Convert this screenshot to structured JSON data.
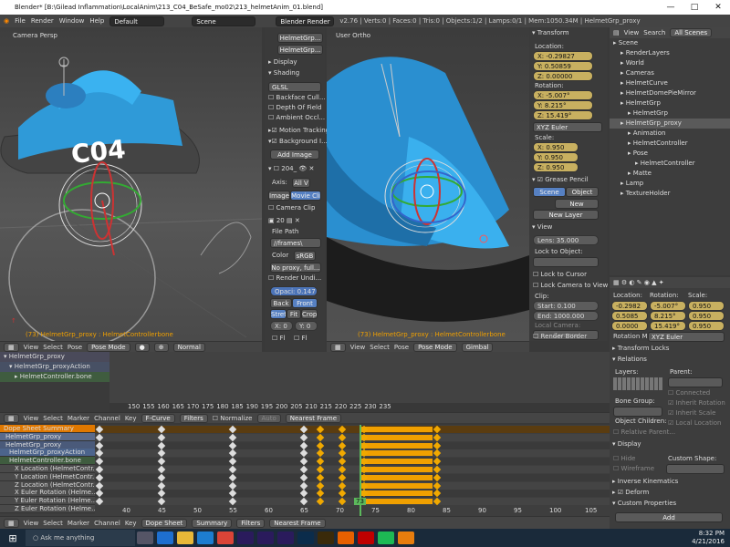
{
  "window": {
    "title": "Blender* [B:\\Gilead Inflammation\\LocalAnim\\213_C04_BeSafe_mo02\\213_helmetAnim_01.blend]",
    "min": "—",
    "max": "□",
    "close": "✕"
  },
  "topbar": {
    "menus": [
      "File",
      "Render",
      "Window",
      "Help"
    ],
    "layout": "Default",
    "scene": "Scene",
    "engine": "Blender Render",
    "info": "v2.76 | Verts:0 | Faces:0 | Tris:0 | Objects:1/2 | Lamps:0/1 | Mem:1050.34M | HelmetGrp_proxy"
  },
  "left_viewport": {
    "label": "Camera Persp",
    "status": "(73) HelmetGrp_proxy : HelmetControllerbone",
    "helmet_text": "C04",
    "menu": [
      "View",
      "Select",
      "Pose"
    ],
    "mode": "Pose Mode",
    "pivot": "Normal"
  },
  "shading_panel": {
    "items": [
      "HelmetGrp...",
      "HelmetGrp..."
    ],
    "display": "Display",
    "shading": "Shading",
    "glsl": "GLSL",
    "checks": [
      "Backface Cull...",
      "Depth Of Field",
      "Ambient Occl...",
      "Motion Tracking",
      "Background I..."
    ],
    "add_image": "Add Image",
    "img_name": "204_",
    "axis_label": "Axis:",
    "axis_val": "All V",
    "image_btn": "Image",
    "movie_btn": "Movie Cli",
    "camera_clip": "Camera Clip",
    "frame": "20",
    "file_path": "File Path",
    "path_val": "//frames\\",
    "color": "Color",
    "srgb": "sRGB",
    "no_proxy": "No proxy, full...",
    "render_undist": "Render Undi...",
    "opac": "Opaci: 0.147",
    "back": "Back",
    "front": "Front",
    "stretch": "Stret",
    "fit": "Fit",
    "crop": "Crop",
    "x": "X: 0",
    "y": "Y: 0",
    "fl": "Fl",
    "fl2": "Fl"
  },
  "right_viewport": {
    "label": "User Ortho",
    "status": "(73) HelmetGrp_proxy : HelmetControllerbone",
    "menu": [
      "View",
      "Select",
      "Pose"
    ],
    "mode": "Pose Mode",
    "orient": "Gimbal"
  },
  "transform": {
    "title": "Transform",
    "location": "Location:",
    "loc": [
      "X: -0.29827",
      "Y: 0.50859",
      "Z: 0.00000"
    ],
    "rotation": "Rotation:",
    "rot": [
      "X: -5.007°",
      "Y: 8.215°",
      "Z: 15.419°"
    ],
    "euler": "XYZ Euler",
    "scale": "Scale:",
    "scl": [
      "X: 0.950",
      "Y: 0.950",
      "Z: 0.950"
    ],
    "grease": "Grease Pencil",
    "scene_btn": "Scene",
    "object_btn": "Object",
    "new": "New",
    "new_layer": "New Layer",
    "view": "View",
    "lens": "Lens: 35.000",
    "lock_obj": "Lock to Object:",
    "lock_cursor": "Lock to Cursor",
    "lock_cam": "Lock Camera to View",
    "clip": "Clip:",
    "start": "Start: 0.100",
    "end": "End: 1000.000",
    "local_camera": "Local Camera:",
    "camera": "Camera",
    "render_border": "Render Border"
  },
  "outliner": {
    "menus": [
      "View",
      "Search",
      "All Scenes"
    ],
    "items": [
      [
        "Scene",
        0
      ],
      [
        "RenderLayers",
        1
      ],
      [
        "World",
        1
      ],
      [
        "Cameras",
        1
      ],
      [
        "HelmetCurve",
        1
      ],
      [
        "HelmetDomePieMirror",
        1
      ],
      [
        "HelmetGrp",
        1
      ],
      [
        "HelmetGrp",
        2
      ],
      [
        "HelmetGrp_proxy",
        1
      ],
      [
        "Animation",
        2
      ],
      [
        "HelmetController",
        2
      ],
      [
        "Pose",
        2
      ],
      [
        "HelmetController",
        3
      ],
      [
        "Matte",
        2
      ],
      [
        "Lamp",
        1
      ],
      [
        "TextureHolder",
        1
      ]
    ]
  },
  "props": {
    "loc_h": "Location:",
    "rot_h": "Rotation:",
    "scl_h": "Scale:",
    "loc": [
      "-0.2982",
      "0.5085",
      "0.0000"
    ],
    "rot": [
      "-5.007°",
      "8.215°",
      "15.419°"
    ],
    "scl": [
      "0.950",
      "0.950",
      "0.950"
    ],
    "rot_mode": "Rotation M:",
    "rot_mode_val": "XYZ Euler",
    "transform_locks": "Transform Locks",
    "relations": "Relations",
    "layers": "Layers:",
    "parent": "Parent:",
    "connected": "Connected",
    "bone_group": "Bone Group:",
    "inherit_rot": "Inherit Rotation",
    "object_children": "Object Children:",
    "inherit_scale": "Inherit Scale",
    "relative_parent": "Relative Parent...",
    "local_location": "Local Location",
    "display": "Display",
    "hide": "Hide",
    "custom_shape": "Custom Shape:",
    "wireframe": "Wireframe",
    "ik": "Inverse Kinematics",
    "deform": "Deform",
    "custom_props": "Custom Properties",
    "add": "Add"
  },
  "timeline": {
    "tree": [
      "HelmetGrp_proxy",
      "HelmetGrp_proxyAction",
      "HelmetController.bone"
    ],
    "ruler": [
      "150",
      "155",
      "160",
      "165",
      "170",
      "175",
      "180",
      "185",
      "190",
      "195",
      "200",
      "205",
      "210",
      "215",
      "220",
      "225",
      "230",
      "235"
    ]
  },
  "dopesheet": {
    "menus": [
      "View",
      "Select",
      "Marker",
      "Channel",
      "Key"
    ],
    "mode": "F-Curve",
    "filters": "Filters",
    "normalize": "Normalize",
    "auto": "Auto",
    "interp": "Nearest Frame",
    "channels": [
      "Dope Sheet Summary",
      "HelmetGrp_proxy",
      "HelmetGrp_proxy",
      "HelmetGrp_proxyAction",
      "HelmetController.bone",
      "X Location (HelmetContr...",
      "Y Location (HelmetContr...",
      "Z Location (HelmetContr...",
      "X Euler Rotation (Helme...",
      "Y Euler Rotation (Helme...",
      "Z Euler Rotation (Helme..."
    ],
    "ruler": [
      "40",
      "45",
      "50",
      "55",
      "60",
      "65",
      "70",
      "75",
      "80",
      "85",
      "90",
      "95",
      "100",
      "105"
    ],
    "current": "73",
    "bottom": {
      "menus": [
        "View",
        "Select",
        "Marker",
        "Channel",
        "Key"
      ],
      "mode": "Dope Sheet",
      "summary": "Summary",
      "filters": "Filters",
      "interp": "Nearest Frame"
    }
  },
  "taskbar": {
    "search": "Ask me anything",
    "time": "8:32 PM",
    "date": "4/21/2016"
  }
}
